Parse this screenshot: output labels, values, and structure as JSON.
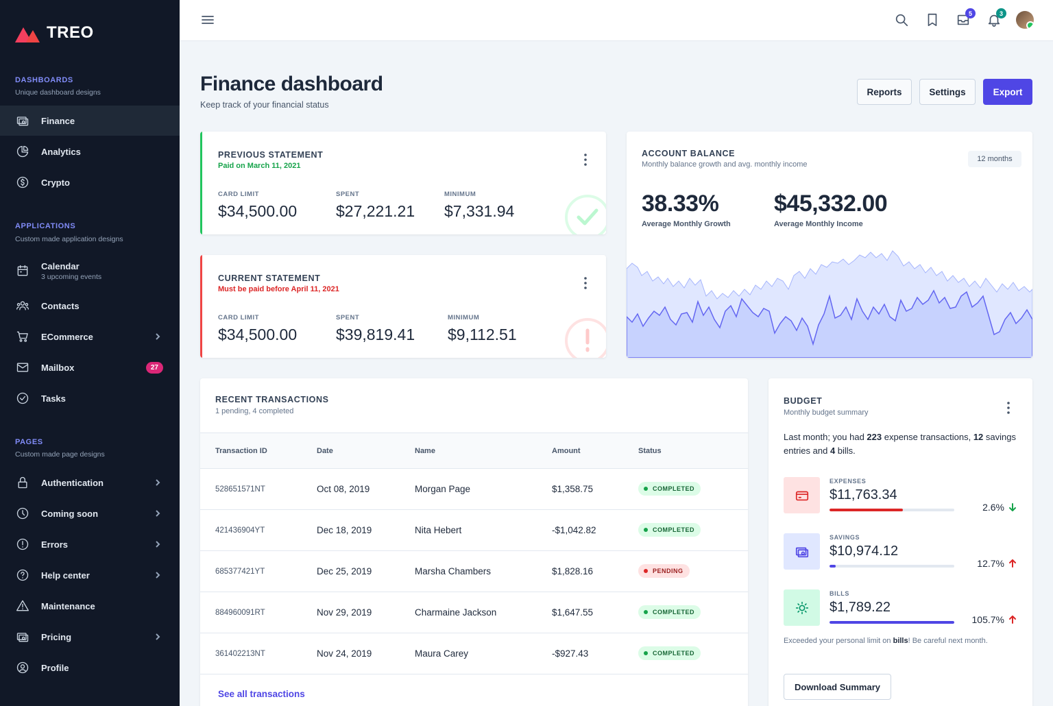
{
  "brand": {
    "name": "TREO"
  },
  "sidebar": {
    "groups": [
      {
        "title": "DASHBOARDS",
        "subtitle": "Unique dashboard designs"
      },
      {
        "title": "APPLICATIONS",
        "subtitle": "Custom made application designs"
      },
      {
        "title": "PAGES",
        "subtitle": "Custom made page designs"
      }
    ],
    "items": [
      {
        "label": "Finance",
        "icon": "cash-icon",
        "active": true
      },
      {
        "label": "Analytics",
        "icon": "chart-pie-icon"
      },
      {
        "label": "Crypto",
        "icon": "currency-dollar-icon"
      },
      {
        "label": "Calendar",
        "sub": "3 upcoming events",
        "icon": "calendar-icon"
      },
      {
        "label": "Contacts",
        "icon": "users-icon"
      },
      {
        "label": "ECommerce",
        "icon": "cart-icon"
      },
      {
        "label": "Mailbox",
        "icon": "mail-icon",
        "badge": "27"
      },
      {
        "label": "Tasks",
        "icon": "check-circle-icon"
      },
      {
        "label": "Authentication",
        "icon": "lock-icon"
      },
      {
        "label": "Coming soon",
        "icon": "clock-icon"
      },
      {
        "label": "Errors",
        "icon": "exclamation-icon"
      },
      {
        "label": "Help center",
        "icon": "question-icon"
      },
      {
        "label": "Maintenance",
        "icon": "warning-icon"
      },
      {
        "label": "Pricing",
        "icon": "cash-icon"
      },
      {
        "label": "Profile",
        "icon": "user-circle-icon"
      }
    ]
  },
  "topbar": {
    "messages_count": "5",
    "notifications_count": "3"
  },
  "header": {
    "title": "Finance dashboard",
    "subtitle": "Keep track of your financial status",
    "buttons": {
      "reports": "Reports",
      "settings": "Settings",
      "export": "Export"
    }
  },
  "previous_statement": {
    "title": "PREVIOUS STATEMENT",
    "note": "Paid on March 11, 2021",
    "card_limit_label": "CARD LIMIT",
    "card_limit": "$34,500.00",
    "spent_label": "SPENT",
    "spent": "$27,221.21",
    "minimum_label": "MINIMUM",
    "minimum": "$7,331.94"
  },
  "current_statement": {
    "title": "CURRENT STATEMENT",
    "note": "Must be paid before April 11, 2021",
    "card_limit_label": "CARD LIMIT",
    "card_limit": "$34,500.00",
    "spent_label": "SPENT",
    "spent": "$39,819.41",
    "minimum_label": "MINIMUM",
    "minimum": "$9,112.51"
  },
  "account_balance": {
    "title": "ACCOUNT BALANCE",
    "subtitle": "Monthly balance growth and avg. monthly income",
    "range": "12 months",
    "growth": "38.33%",
    "growth_label": "Average Monthly Growth",
    "income": "$45,332.00",
    "income_label": "Average Monthly Income"
  },
  "transactions": {
    "title": "RECENT TRANSACTIONS",
    "subtitle": "1 pending, 4 completed",
    "columns": [
      "Transaction ID",
      "Date",
      "Name",
      "Amount",
      "Status"
    ],
    "rows": [
      {
        "id": "528651571NT",
        "date": "Oct 08, 2019",
        "name": "Morgan Page",
        "amount": "$1,358.75",
        "status": "COMPLETED"
      },
      {
        "id": "421436904YT",
        "date": "Dec 18, 2019",
        "name": "Nita Hebert",
        "amount": "-$1,042.82",
        "status": "COMPLETED"
      },
      {
        "id": "685377421YT",
        "date": "Dec 25, 2019",
        "name": "Marsha Chambers",
        "amount": "$1,828.16",
        "status": "PENDING"
      },
      {
        "id": "884960091RT",
        "date": "Nov 29, 2019",
        "name": "Charmaine Jackson",
        "amount": "$1,647.55",
        "status": "COMPLETED"
      },
      {
        "id": "361402213NT",
        "date": "Nov 24, 2019",
        "name": "Maura Carey",
        "amount": "-$927.43",
        "status": "COMPLETED"
      }
    ],
    "see_all": "See all transactions"
  },
  "budget": {
    "title": "BUDGET",
    "subtitle": "Monthly budget summary",
    "desc_pre": "Last month; you had ",
    "desc_expense_count": "223",
    "desc_mid1": " expense transactions, ",
    "desc_savings_count": "12",
    "desc_mid2": " savings entries and ",
    "desc_bills_count": "4",
    "desc_post": " bills.",
    "items": [
      {
        "label": "EXPENSES",
        "value": "$11,763.34",
        "progress": 0.59,
        "pct": "2.6%",
        "trend": "down",
        "color": "#dc2626",
        "bg": "#fee2e2",
        "icon": "credit-card-icon"
      },
      {
        "label": "SAVINGS",
        "value": "$10,974.12",
        "progress": 0.05,
        "pct": "12.7%",
        "trend": "up",
        "color": "#4f46e5",
        "bg": "#e0e7ff",
        "icon": "cash-icon"
      },
      {
        "label": "BILLS",
        "value": "$1,789.22",
        "progress": 1.0,
        "pct": "105.7%",
        "trend": "up",
        "color": "#4f46e5",
        "bg": "#d1fae5",
        "icon": "lightbulb-icon"
      }
    ],
    "warn_pre": "Exceeded your personal limit on ",
    "warn_bold": "bills",
    "warn_post": "! Be careful next month.",
    "download": "Download Summary"
  },
  "colors": {
    "accent": "#4f46e5",
    "success": "#22c55e",
    "danger": "#ef4444",
    "sidebar": "#111827"
  }
}
